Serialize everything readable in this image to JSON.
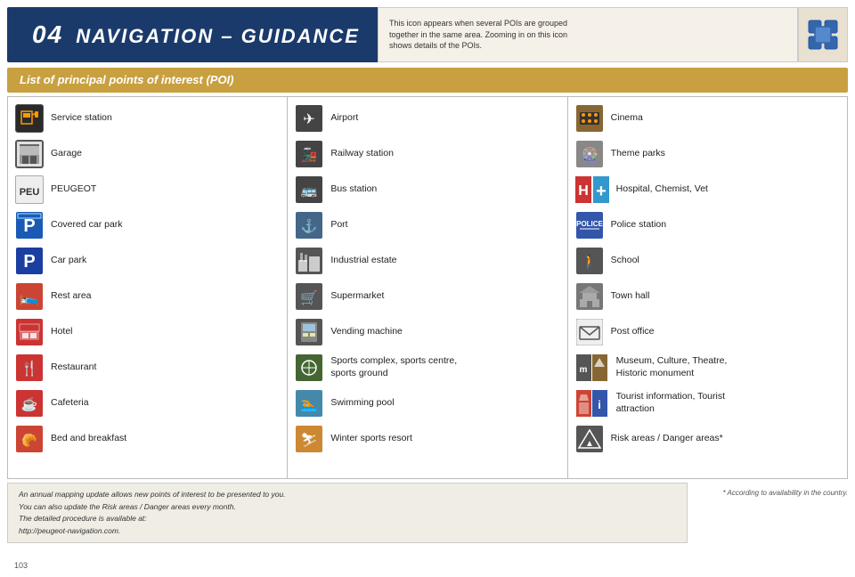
{
  "header": {
    "chapter_num": "04",
    "title": "NAVIGATION – GUIDANCE",
    "note": "This icon appears when several POIs are grouped\ntogether in the same area. Zooming in on this icon\nshows details of the POIs.",
    "icon_alt": "cluster-icon"
  },
  "section": {
    "title": "List of principal points of interest (POI)"
  },
  "columns": [
    {
      "id": "col1",
      "items": [
        {
          "id": "service-station",
          "label": "Service station",
          "icon": "⛽"
        },
        {
          "id": "garage",
          "label": "Garage",
          "icon": "🔧"
        },
        {
          "id": "peugeot",
          "label": "PEUGEOT",
          "icon": "🦁"
        },
        {
          "id": "covered-car-park",
          "label": "Covered car park",
          "icon": "P"
        },
        {
          "id": "car-park",
          "label": "Car park",
          "icon": "P"
        },
        {
          "id": "rest-area",
          "label": "Rest area",
          "icon": "🛖"
        },
        {
          "id": "hotel",
          "label": "Hotel",
          "icon": "🛏"
        },
        {
          "id": "restaurant",
          "label": "Restaurant",
          "icon": "🍴"
        },
        {
          "id": "cafeteria",
          "label": "Cafeteria",
          "icon": "☕"
        },
        {
          "id": "bed-breakfast",
          "label": "Bed and breakfast",
          "icon": "🥐"
        }
      ]
    },
    {
      "id": "col2",
      "items": [
        {
          "id": "airport",
          "label": "Airport",
          "icon": "✈"
        },
        {
          "id": "railway-station",
          "label": "Railway station",
          "icon": "🚂"
        },
        {
          "id": "bus-station",
          "label": "Bus station",
          "icon": "🚌"
        },
        {
          "id": "port",
          "label": "Port",
          "icon": "⚓"
        },
        {
          "id": "industrial-estate",
          "label": "Industrial estate",
          "icon": "🏭"
        },
        {
          "id": "supermarket",
          "label": "Supermarket",
          "icon": "🛒"
        },
        {
          "id": "vending-machine",
          "label": "Vending machine",
          "icon": "🏧"
        },
        {
          "id": "sports-complex",
          "label": "Sports complex, sports centre,\nsports ground",
          "icon": "⚽"
        },
        {
          "id": "swimming-pool",
          "label": "Swimming pool",
          "icon": "🏊"
        },
        {
          "id": "winter-sports",
          "label": "Winter sports resort",
          "icon": "⛷"
        }
      ]
    },
    {
      "id": "col3",
      "items": [
        {
          "id": "cinema",
          "label": "Cinema",
          "icon": "🎬"
        },
        {
          "id": "theme-parks",
          "label": "Theme parks",
          "icon": "🎡"
        },
        {
          "id": "hospital",
          "label": "Hospital, Chemist, Vet",
          "icon": "H+"
        },
        {
          "id": "police-station",
          "label": "Police station",
          "icon": "POLICE"
        },
        {
          "id": "school",
          "label": "School",
          "icon": "🎓"
        },
        {
          "id": "town-hall",
          "label": "Town hall",
          "icon": "🏛"
        },
        {
          "id": "post-office",
          "label": "Post office",
          "icon": "✉"
        },
        {
          "id": "museum",
          "label": "Museum, Culture, Theatre,\nHistoric monument",
          "icon": "m"
        },
        {
          "id": "tourist-info",
          "label": "Tourist information, Tourist\nattraction",
          "icon": "i"
        },
        {
          "id": "risk-areas",
          "label": "Risk areas / Danger areas*",
          "icon": "⚠"
        }
      ]
    }
  ],
  "bottom_note": {
    "main_text": "An annual mapping update allows new points of interest to be presented to you.\nYou can also update the Risk areas / Danger areas every month.\nThe detailed procedure is available at:\nhttp://peugeot-navigation.com.",
    "footnote": "* According to availability in the country."
  },
  "page_number": "103"
}
